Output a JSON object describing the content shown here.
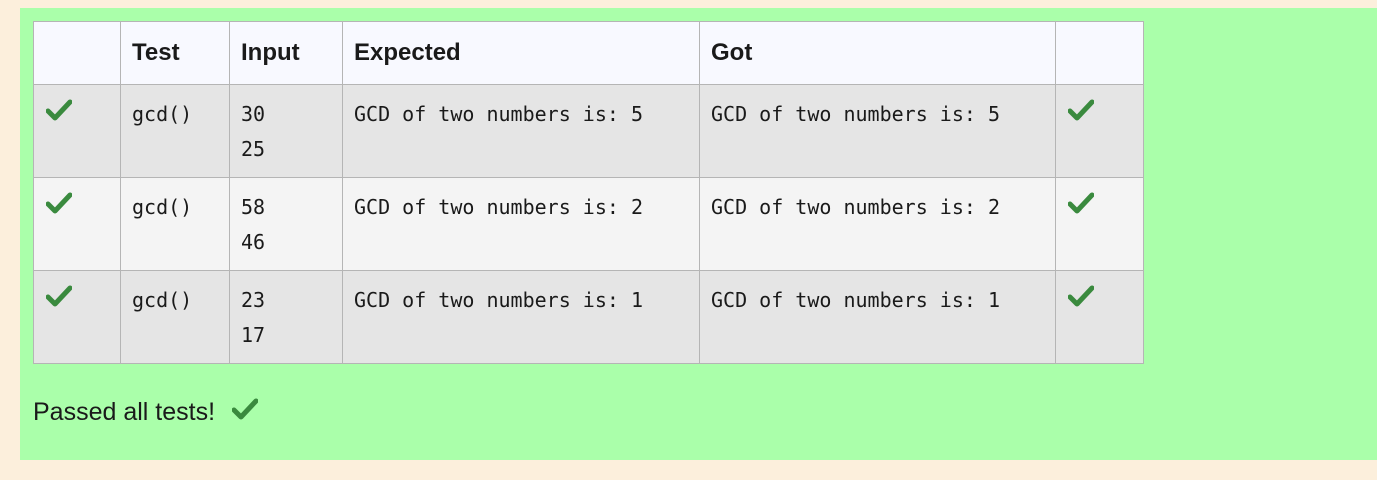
{
  "table": {
    "headers": [
      "",
      "Test",
      "Input",
      "Expected",
      "Got",
      ""
    ],
    "rows": [
      {
        "status": "check-icon",
        "test": "gcd()",
        "input": "30\n25",
        "expected": "GCD of two numbers is: 5",
        "got": "GCD of two numbers is: 5",
        "result": "check-icon"
      },
      {
        "status": "check-icon",
        "test": "gcd()",
        "input": "58\n46",
        "expected": "GCD of two numbers is: 2",
        "got": "GCD of two numbers is: 2",
        "result": "check-icon"
      },
      {
        "status": "check-icon",
        "test": "gcd()",
        "input": "23\n17",
        "expected": "GCD of two numbers is: 1",
        "got": "GCD of two numbers is: 1",
        "result": "check-icon"
      }
    ]
  },
  "summary": {
    "text": "Passed all tests!",
    "icon": "check-icon"
  },
  "colors": {
    "pass_panel": "#aaffaa",
    "page_bg": "#fcefdc",
    "check": "#3a8a3e"
  }
}
